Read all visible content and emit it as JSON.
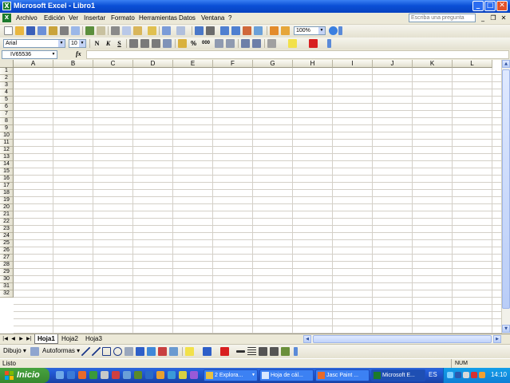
{
  "window": {
    "title": "Microsoft Excel - Libro1",
    "minimize": "_",
    "maximize": "□",
    "close": "✕"
  },
  "menubar": {
    "items": [
      "Archivo",
      "Edición",
      "Ver",
      "Insertar",
      "Formato",
      "Herramientas",
      "Datos",
      "Ventana",
      "?"
    ],
    "help_placeholder": "Escriba una pregunta"
  },
  "standard_toolbar": {
    "zoom": "100%"
  },
  "format_toolbar": {
    "font": "Arial",
    "size": "10",
    "bold": "N",
    "italic": "K",
    "underline": "S",
    "percent": "%",
    "thousands": "000"
  },
  "formula_bar": {
    "name_box": "IV65536",
    "fx": "fx",
    "value": ""
  },
  "grid": {
    "columns": [
      "A",
      "B",
      "C",
      "D",
      "E",
      "F",
      "G",
      "H",
      "I",
      "J",
      "K",
      "L"
    ],
    "rows": [
      "1",
      "2",
      "3",
      "4",
      "5",
      "6",
      "7",
      "8",
      "9",
      "10",
      "11",
      "12",
      "13",
      "14",
      "15",
      "16",
      "17",
      "18",
      "19",
      "20",
      "21",
      "22",
      "23",
      "24",
      "25",
      "26",
      "27",
      "28",
      "29",
      "30",
      "31",
      "32"
    ]
  },
  "sheets": {
    "tabs": [
      "Hoja1",
      "Hoja2",
      "Hoja3"
    ],
    "active": "Hoja1"
  },
  "drawing_toolbar": {
    "draw": "Dibujo ▾",
    "autoshapes": "Autoformas ▾"
  },
  "statusbar": {
    "text": "Listo",
    "num": "NUM"
  },
  "taskbar": {
    "start": "Inicio",
    "tasks": [
      {
        "label": "2 Explora...",
        "active": false
      },
      {
        "label": "Hoja de cál...",
        "active": false
      },
      {
        "label": "Jasc Paint ...",
        "active": false
      },
      {
        "label": "Microsoft E...",
        "active": true
      }
    ],
    "lang": "ES",
    "clock": "14:10"
  },
  "colors": {
    "titlebar": "#0a4fd6",
    "taskbar": "#245edb",
    "start": "#37882e",
    "tray": "#0e7fd6"
  }
}
